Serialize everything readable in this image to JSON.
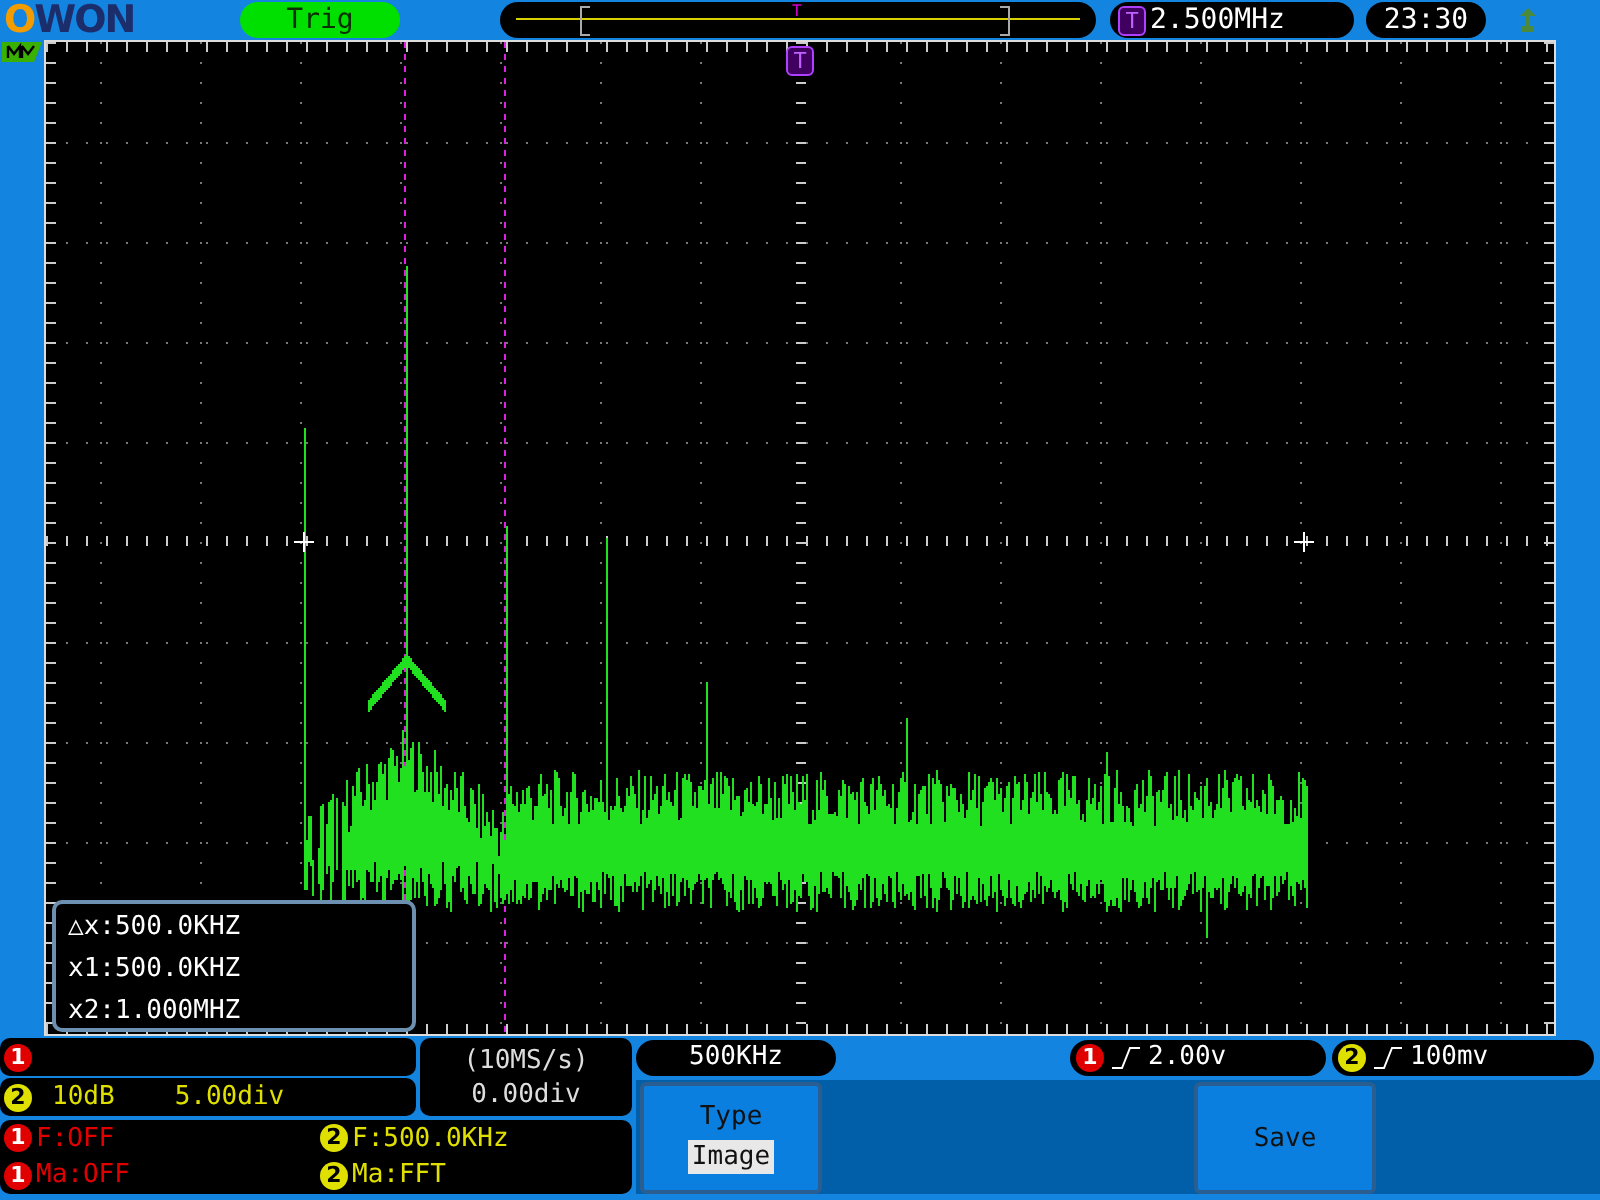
{
  "top_bar": {
    "logo": "OWON",
    "trigger_status": "Trig",
    "trigger_pointer": "T",
    "trigger_source": "T",
    "frequency": "2.500MHz",
    "time": "23:30"
  },
  "display": {
    "trigger_marker": "T",
    "cursor_readout": [
      "△x:500.0KHZ",
      "x1:500.0KHZ",
      "x2:1.000MHZ"
    ]
  },
  "channels": [
    {
      "badge": "1",
      "color": "#e00000"
    },
    {
      "badge": "2",
      "color": "#e0e000",
      "scale": "10dB",
      "position": "5.00div"
    }
  ],
  "timebase": {
    "sample_rate": "(10MS/s)",
    "position": "0.00div"
  },
  "fft_scale": "500KHz",
  "triggers": [
    {
      "badge": "1",
      "color": "#e00000",
      "level": "2.00v"
    },
    {
      "badge": "2",
      "color": "#e0e000",
      "level": "100mv"
    }
  ],
  "math": [
    {
      "badge": "1",
      "color": "#e00000",
      "text": "F:OFF"
    },
    {
      "badge": "2",
      "color": "#e0e000",
      "text": "F:500.0KHz"
    },
    {
      "badge": "1",
      "color": "#e00000",
      "text": "Ma:OFF"
    },
    {
      "badge": "2",
      "color": "#e0e000",
      "text": "Ma:FFT"
    }
  ],
  "menu": [
    {
      "kind": "option",
      "label": "Type",
      "value": "Image"
    },
    {
      "kind": "action",
      "label": "Save"
    }
  ]
}
